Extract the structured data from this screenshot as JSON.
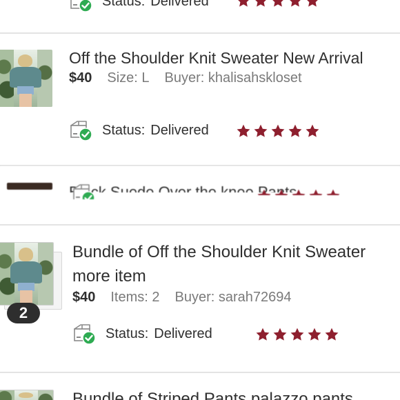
{
  "colors": {
    "star": "#8e1f2e",
    "check": "#2eab52",
    "divider": "#e3e3e3",
    "badge_bg": "#2e2e2e"
  },
  "orders": [
    {
      "status_label": "Status:",
      "status_value": "Delivered",
      "rating": 5
    },
    {
      "title": "Off the Shoulder Knit Sweater New Arrival",
      "price": "$40",
      "size": "Size: L",
      "buyer": "Buyer: khalisahskloset",
      "status_label": "Status:",
      "status_value": "Delivered",
      "rating": 5
    },
    {
      "title": "Black Suede Over the knee Pants",
      "rating": 5
    },
    {
      "title_line1": "Bundle of Off the Shoulder Knit Sweater",
      "title_line2": "more item",
      "price": "$40",
      "items": "Items: 2",
      "buyer": "Buyer: sarah72694",
      "count_badge": "2",
      "status_label": "Status:",
      "status_value": "Delivered",
      "rating": 5
    },
    {
      "title": "Bundle of Striped Pants palazzo pants"
    }
  ],
  "icons": {
    "package": "package-delivered-icon",
    "star": "star-icon"
  }
}
